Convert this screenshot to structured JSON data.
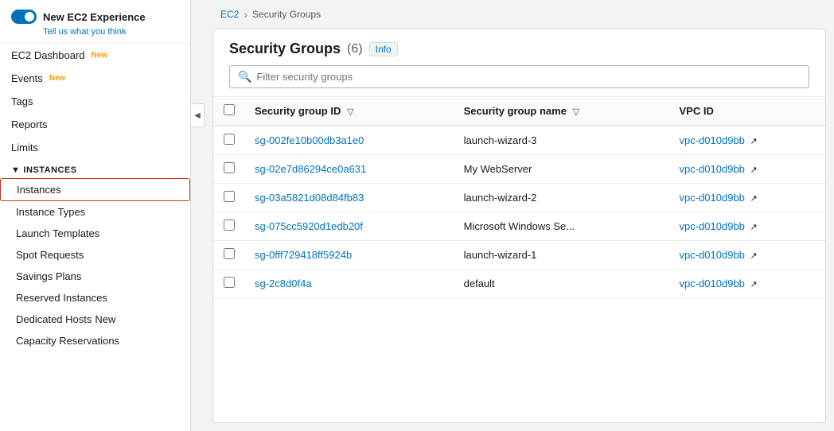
{
  "brand": {
    "label": "New EC2 Experience",
    "subLabel": "Tell us what you think"
  },
  "sidebar": {
    "items": [
      {
        "id": "ec2-dashboard",
        "label": "EC2 Dashboard",
        "badge": "New",
        "indent": false
      },
      {
        "id": "events",
        "label": "Events",
        "badge": "New",
        "indent": false
      },
      {
        "id": "tags",
        "label": "Tags",
        "badge": null,
        "indent": false
      },
      {
        "id": "reports",
        "label": "Reports",
        "badge": null,
        "indent": false
      },
      {
        "id": "limits",
        "label": "Limits",
        "badge": null,
        "indent": false
      }
    ],
    "instances_section": "INSTANCES",
    "instance_items": [
      {
        "id": "instances",
        "label": "Instances",
        "active": true
      },
      {
        "id": "instance-types",
        "label": "Instance Types"
      },
      {
        "id": "launch-templates",
        "label": "Launch Templates"
      },
      {
        "id": "spot-requests",
        "label": "Spot Requests"
      },
      {
        "id": "savings-plans",
        "label": "Savings Plans"
      },
      {
        "id": "reserved-instances",
        "label": "Reserved Instances"
      },
      {
        "id": "dedicated-hosts",
        "label": "Dedicated Hosts",
        "badge": "New"
      },
      {
        "id": "capacity-reservations",
        "label": "Capacity Reservations"
      }
    ]
  },
  "breadcrumb": {
    "items": [
      {
        "label": "EC2",
        "link": true
      },
      {
        "label": "Security Groups",
        "link": false
      }
    ]
  },
  "page": {
    "title": "Security Groups",
    "count": "(6)",
    "info_label": "Info",
    "search_placeholder": "Filter security groups"
  },
  "table": {
    "columns": [
      {
        "id": "checkbox",
        "label": ""
      },
      {
        "id": "sg-id",
        "label": "Security group ID",
        "sortable": true
      },
      {
        "id": "sg-name",
        "label": "Security group name",
        "sortable": true
      },
      {
        "id": "vpc-id",
        "label": "VPC ID",
        "sortable": false
      }
    ],
    "rows": [
      {
        "sg_id": "sg-002fe10b00db3a1e0",
        "sg_name": "launch-wizard-3",
        "vpc_id": "vpc-d010d9bb"
      },
      {
        "sg_id": "sg-02e7d86294ce0a631",
        "sg_name": "My WebServer",
        "vpc_id": "vpc-d010d9bb"
      },
      {
        "sg_id": "sg-03a5821d08d84fb83",
        "sg_name": "launch-wizard-2",
        "vpc_id": "vpc-d010d9bb"
      },
      {
        "sg_id": "sg-075cc5920d1edb20f",
        "sg_name": "Microsoft Windows Se...",
        "vpc_id": "vpc-d010d9bb"
      },
      {
        "sg_id": "sg-0fff729418ff5924b",
        "sg_name": "launch-wizard-1",
        "vpc_id": "vpc-d010d9bb"
      },
      {
        "sg_id": "sg-2c8d0f4a",
        "sg_name": "default",
        "vpc_id": "vpc-d010d9bb"
      }
    ]
  }
}
